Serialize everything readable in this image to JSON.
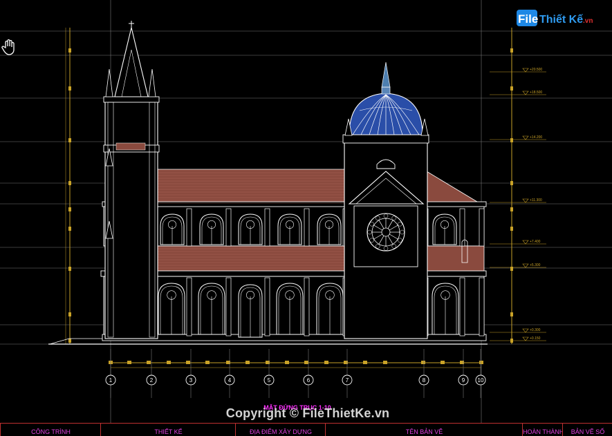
{
  "logo": {
    "prefix": "File",
    "suffix": "Thiết Kế",
    "tld": ".vn"
  },
  "elevation_levels": [
    "+20.500",
    "+18.500",
    "+14.200",
    "+11.300",
    "+7.400",
    "+5.300",
    "+0.300",
    "+0.150"
  ],
  "axis_labels": [
    "1",
    "2",
    "3",
    "4",
    "5",
    "6",
    "7",
    "8",
    "9",
    "10"
  ],
  "drawing_title": "MẶT ĐỨNG TRỤC 1-10",
  "copyright": "Copyright © FileThietKe.vn",
  "title_block": [
    "CÔNG TRÌNH",
    "THIẾT KẾ",
    "ĐỊA ĐIỂM XÂY DỰNG",
    "TÊN BẢN VẼ",
    "HOÀN THÀNH",
    "BẢN VẼ SỐ"
  ],
  "colors": {
    "background": "#000000",
    "gridline": "#7a7a7a",
    "linework": "#ffffff",
    "roof": "#8a4a3e",
    "dome": "#2a4ea8",
    "dimension": "#c9a227",
    "label": "#ff30ff"
  },
  "icons": {
    "pan": "hand-pan-icon"
  }
}
